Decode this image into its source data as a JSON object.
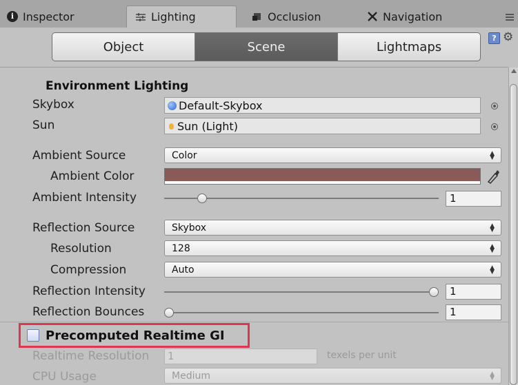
{
  "tabs": [
    {
      "label": "Inspector",
      "icon": "info-icon",
      "active": false
    },
    {
      "label": "Lighting",
      "icon": "lighting-icon",
      "active": true
    },
    {
      "label": "Occlusion",
      "icon": "occlusion-icon",
      "active": false
    },
    {
      "label": "Navigation",
      "icon": "navigation-icon",
      "active": false
    }
  ],
  "toolbar": {
    "segments": [
      "Object",
      "Scene",
      "Lightmaps"
    ],
    "selected": "Scene"
  },
  "environment": {
    "header": "Environment Lighting",
    "skybox_label": "Skybox",
    "skybox_value": "Default-Skybox",
    "sun_label": "Sun",
    "sun_value": "Sun (Light)",
    "ambient_source_label": "Ambient Source",
    "ambient_source_value": "Color",
    "ambient_color_label": "Ambient Color",
    "ambient_color_hex": "#8a5a58",
    "ambient_intensity_label": "Ambient Intensity",
    "ambient_intensity_value": "1",
    "ambient_intensity_slider": 0.125,
    "reflection_source_label": "Reflection Source",
    "reflection_source_value": "Skybox",
    "resolution_label": "Resolution",
    "resolution_value": "128",
    "compression_label": "Compression",
    "compression_value": "Auto",
    "reflection_intensity_label": "Reflection Intensity",
    "reflection_intensity_value": "1",
    "reflection_intensity_slider": 1.0,
    "reflection_bounces_label": "Reflection Bounces",
    "reflection_bounces_value": "1",
    "reflection_bounces_slider": 0.0
  },
  "realtime_gi": {
    "title": "Precomputed Realtime GI",
    "enabled": false,
    "realtime_resolution_label": "Realtime Resolution",
    "realtime_resolution_value": "1",
    "units_label": "texels per unit",
    "cpu_usage_label": "CPU Usage",
    "cpu_usage_value": "Medium"
  },
  "colors": {
    "highlight": "#e0354f",
    "active_segment": "#5f5f5f"
  }
}
